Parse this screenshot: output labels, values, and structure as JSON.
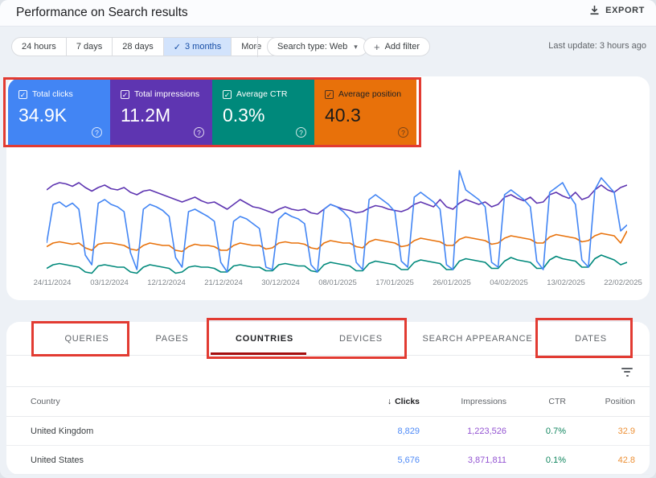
{
  "header": {
    "title": "Performance on Search results",
    "export_label": "EXPORT"
  },
  "filters": {
    "ranges": [
      "24 hours",
      "7 days",
      "28 days",
      "3 months"
    ],
    "selected_range": "3 months",
    "more_label": "More",
    "search_type_label": "Search type: Web",
    "add_filter_label": "Add filter",
    "last_update": "Last update: 3 hours ago"
  },
  "icons": {
    "check": "✓",
    "caret": "▾",
    "plus": "+",
    "sort_desc": "↓",
    "help": "?"
  },
  "metrics": {
    "cards": [
      {
        "label": "Total clicks",
        "value": "34.9K",
        "color": "#4285f4",
        "dark_text": false
      },
      {
        "label": "Total impressions",
        "value": "11.2M",
        "color": "#5e35b1",
        "dark_text": false
      },
      {
        "label": "Average CTR",
        "value": "0.3%",
        "color": "#00897b",
        "dark_text": false
      },
      {
        "label": "Average position",
        "value": "40.3",
        "color": "#e8710a",
        "dark_text": true
      }
    ]
  },
  "chart_data": {
    "type": "line",
    "title": "",
    "xlabel": "",
    "ylabel": "",
    "y_axis_note": "no y-axis shown; series values are normalized 0-100 of plot height",
    "grid": false,
    "legend_position": "none (legend = metric cards above)",
    "x_labels": [
      "24/11/2024",
      "03/12/2024",
      "12/12/2024",
      "21/12/2024",
      "30/12/2024",
      "08/01/2025",
      "17/01/2025",
      "26/01/2025",
      "04/02/2025",
      "13/02/2025",
      "22/02/2025"
    ],
    "series": [
      {
        "name": "CTR",
        "color": "#00897b",
        "values": [
          9,
          12,
          13,
          12,
          11,
          10,
          6,
          5,
          11,
          12,
          11,
          10,
          10,
          6,
          5,
          10,
          12,
          11,
          10,
          9,
          5,
          6,
          10,
          11,
          10,
          10,
          9,
          6,
          6,
          11,
          12,
          11,
          10,
          10,
          7,
          7,
          12,
          13,
          12,
          11,
          11,
          7,
          6,
          12,
          14,
          13,
          12,
          11,
          7,
          7,
          13,
          15,
          14,
          13,
          12,
          8,
          8,
          14,
          16,
          15,
          14,
          13,
          8,
          8,
          15,
          17,
          16,
          15,
          14,
          9,
          9,
          15,
          18,
          16,
          15,
          14,
          9,
          9,
          16,
          19,
          17,
          16,
          15,
          10,
          10,
          17,
          20,
          18,
          16,
          12,
          14
        ]
      },
      {
        "name": "Position",
        "color": "#e8710a",
        "values": [
          27,
          30,
          31,
          30,
          29,
          30,
          26,
          24,
          29,
          30,
          30,
          29,
          28,
          25,
          24,
          28,
          30,
          29,
          28,
          28,
          24,
          23,
          27,
          29,
          28,
          28,
          27,
          24,
          24,
          28,
          30,
          29,
          28,
          28,
          25,
          26,
          30,
          31,
          30,
          30,
          29,
          26,
          25,
          30,
          32,
          31,
          30,
          30,
          27,
          26,
          31,
          33,
          32,
          31,
          30,
          27,
          28,
          32,
          34,
          33,
          32,
          31,
          28,
          28,
          33,
          35,
          34,
          33,
          32,
          29,
          30,
          34,
          36,
          35,
          34,
          33,
          30,
          30,
          35,
          37,
          36,
          35,
          34,
          31,
          32,
          36,
          38,
          37,
          36,
          30,
          40
        ]
      },
      {
        "name": "Impressions",
        "color": "#5e35b1",
        "values": [
          74,
          78,
          80,
          79,
          77,
          80,
          76,
          73,
          76,
          78,
          75,
          74,
          76,
          72,
          70,
          73,
          74,
          72,
          70,
          68,
          66,
          64,
          66,
          68,
          65,
          63,
          64,
          61,
          58,
          62,
          66,
          63,
          60,
          59,
          57,
          55,
          58,
          60,
          58,
          57,
          58,
          55,
          54,
          58,
          62,
          60,
          58,
          57,
          55,
          56,
          59,
          61,
          60,
          58,
          57,
          56,
          58,
          62,
          64,
          62,
          60,
          66,
          60,
          58,
          63,
          66,
          64,
          62,
          64,
          60,
          62,
          68,
          70,
          67,
          65,
          68,
          63,
          64,
          70,
          72,
          69,
          67,
          72,
          66,
          68,
          74,
          78,
          74,
          72,
          76,
          78
        ]
      },
      {
        "name": "Clicks",
        "color": "#4285f4",
        "values": [
          30,
          62,
          64,
          60,
          63,
          58,
          20,
          12,
          63,
          66,
          62,
          60,
          56,
          22,
          8,
          58,
          62,
          60,
          57,
          52,
          18,
          10,
          56,
          58,
          55,
          52,
          48,
          14,
          6,
          48,
          52,
          50,
          46,
          42,
          10,
          8,
          50,
          55,
          52,
          50,
          46,
          12,
          6,
          58,
          62,
          60,
          56,
          50,
          14,
          8,
          66,
          70,
          66,
          62,
          56,
          15,
          10,
          68,
          72,
          68,
          64,
          58,
          12,
          8,
          90,
          74,
          70,
          66,
          60,
          14,
          10,
          70,
          74,
          70,
          66,
          60,
          15,
          8,
          72,
          76,
          80,
          70,
          62,
          16,
          10,
          74,
          84,
          78,
          72,
          40,
          45
        ]
      }
    ]
  },
  "tabs": {
    "items": [
      "QUERIES",
      "PAGES",
      "COUNTRIES",
      "DEVICES",
      "SEARCH APPEARANCE",
      "DATES"
    ],
    "active": "COUNTRIES"
  },
  "table": {
    "columns": [
      "Country",
      "Clicks",
      "Impressions",
      "CTR",
      "Position"
    ],
    "sort_column": "Clicks",
    "colors": {
      "clicks": "#4e8af7",
      "impressions": "#9353d2",
      "ctr": "#11865f",
      "position": "#ed9036"
    },
    "rows": [
      {
        "country": "United Kingdom",
        "clicks": "8,829",
        "impressions": "1,223,526",
        "ctr": "0.7%",
        "position": "32.9"
      },
      {
        "country": "United States",
        "clicks": "5,676",
        "impressions": "3,871,811",
        "ctr": "0.1%",
        "position": "42.8"
      }
    ]
  },
  "annotations": {
    "color": "#e23b32",
    "highlighted": [
      "metric cards",
      "QUERIES tab",
      "COUNTRIES + DEVICES tabs",
      "DATES tab"
    ]
  }
}
